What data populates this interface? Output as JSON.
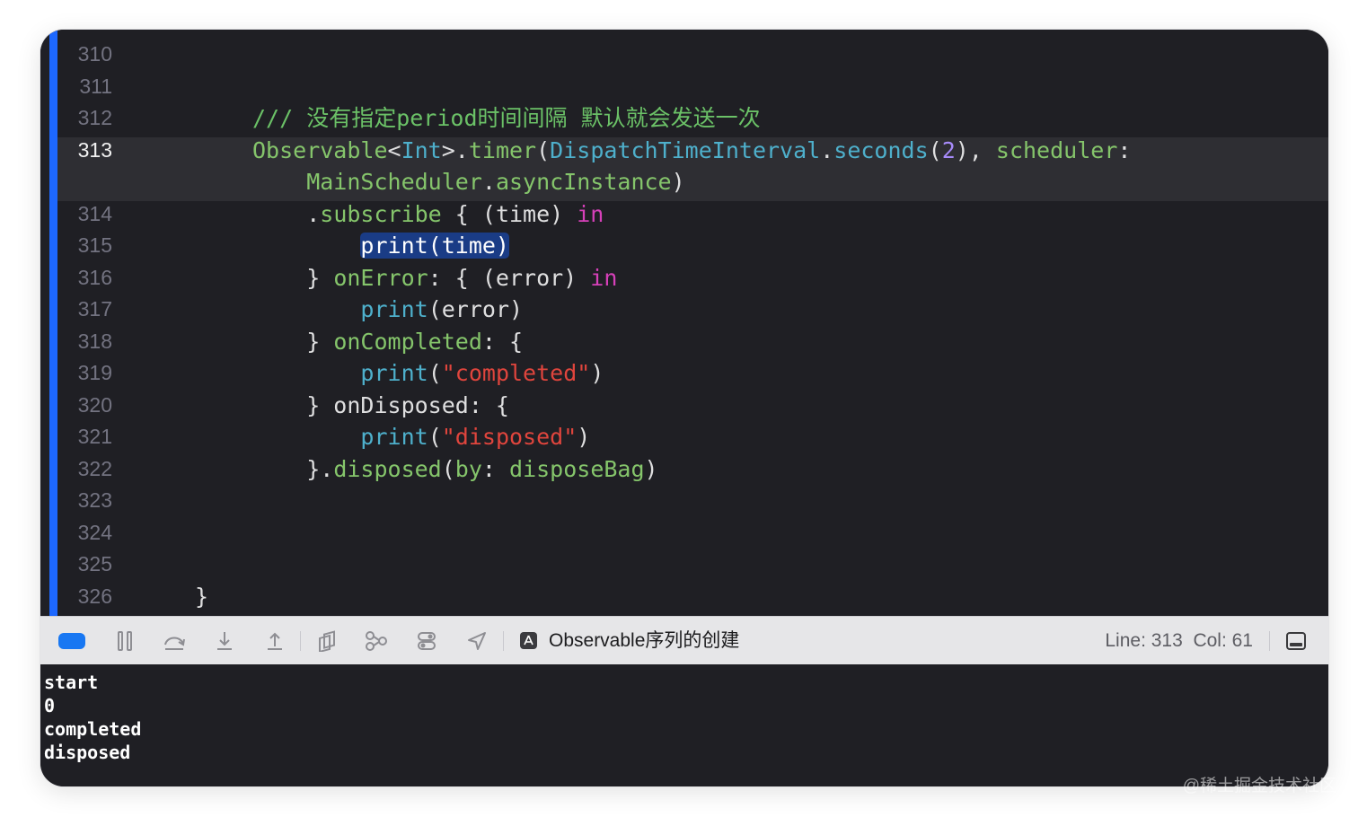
{
  "editor": {
    "lines": [
      {
        "num": "310",
        "current": false,
        "tokens": []
      },
      {
        "num": "311",
        "current": false,
        "tokens": []
      },
      {
        "num": "312",
        "current": false,
        "tokens": [
          {
            "t": "/// 没有指定period时间间隔 默认就会发送一次",
            "c": "c-comment"
          }
        ]
      },
      {
        "num": "313",
        "current": true,
        "tokens": [
          {
            "t": "Observable",
            "c": "c-green"
          },
          {
            "t": "<",
            "c": "c-white"
          },
          {
            "t": "Int",
            "c": "c-cyan"
          },
          {
            "t": ">.",
            "c": "c-white"
          },
          {
            "t": "timer",
            "c": "c-green"
          },
          {
            "t": "(",
            "c": "c-white"
          },
          {
            "t": "DispatchTimeInterval",
            "c": "c-cyan"
          },
          {
            "t": ".",
            "c": "c-white"
          },
          {
            "t": "seconds",
            "c": "c-cyan"
          },
          {
            "t": "(",
            "c": "c-white"
          },
          {
            "t": "2",
            "c": "c-num"
          },
          {
            "t": "), ",
            "c": "c-white"
          },
          {
            "t": "scheduler",
            "c": "c-green"
          },
          {
            "t": ":",
            "c": "c-white"
          }
        ]
      },
      {
        "num": "",
        "current": true,
        "tokens": [
          {
            "t": "    MainScheduler",
            "c": "c-green"
          },
          {
            "t": ".",
            "c": "c-white"
          },
          {
            "t": "asyncInstance",
            "c": "c-green"
          },
          {
            "t": ")",
            "c": "c-white"
          }
        ]
      },
      {
        "num": "314",
        "current": false,
        "tokens": [
          {
            "t": "    .",
            "c": "c-white"
          },
          {
            "t": "subscribe",
            "c": "c-green"
          },
          {
            "t": " { (time) ",
            "c": "c-white"
          },
          {
            "t": "in",
            "c": "c-kw"
          }
        ]
      },
      {
        "num": "315",
        "current": false,
        "tokens": [
          {
            "t": "        ",
            "c": "c-white"
          },
          {
            "t": "print(time)",
            "c": "sel"
          }
        ]
      },
      {
        "num": "316",
        "current": false,
        "tokens": [
          {
            "t": "    } ",
            "c": "c-white"
          },
          {
            "t": "onError",
            "c": "c-green"
          },
          {
            "t": ": { (error) ",
            "c": "c-white"
          },
          {
            "t": "in",
            "c": "c-kw"
          }
        ]
      },
      {
        "num": "317",
        "current": false,
        "tokens": [
          {
            "t": "        ",
            "c": "c-white"
          },
          {
            "t": "print",
            "c": "c-cyan"
          },
          {
            "t": "(error)",
            "c": "c-white"
          }
        ]
      },
      {
        "num": "318",
        "current": false,
        "tokens": [
          {
            "t": "    } ",
            "c": "c-white"
          },
          {
            "t": "onCompleted",
            "c": "c-green"
          },
          {
            "t": ": {",
            "c": "c-white"
          }
        ]
      },
      {
        "num": "319",
        "current": false,
        "tokens": [
          {
            "t": "        ",
            "c": "c-white"
          },
          {
            "t": "print",
            "c": "c-cyan"
          },
          {
            "t": "(",
            "c": "c-white"
          },
          {
            "t": "\"completed\"",
            "c": "c-str"
          },
          {
            "t": ")",
            "c": "c-white"
          }
        ]
      },
      {
        "num": "320",
        "current": false,
        "tokens": [
          {
            "t": "    } onDisposed: {",
            "c": "c-white"
          }
        ]
      },
      {
        "num": "321",
        "current": false,
        "tokens": [
          {
            "t": "        ",
            "c": "c-white"
          },
          {
            "t": "print",
            "c": "c-cyan"
          },
          {
            "t": "(",
            "c": "c-white"
          },
          {
            "t": "\"disposed\"",
            "c": "c-str"
          },
          {
            "t": ")",
            "c": "c-white"
          }
        ]
      },
      {
        "num": "322",
        "current": false,
        "tokens": [
          {
            "t": "    }.",
            "c": "c-white"
          },
          {
            "t": "disposed",
            "c": "c-green"
          },
          {
            "t": "(",
            "c": "c-white"
          },
          {
            "t": "by",
            "c": "c-green"
          },
          {
            "t": ": ",
            "c": "c-white"
          },
          {
            "t": "disposeBag",
            "c": "c-green"
          },
          {
            "t": ")",
            "c": "c-white"
          }
        ]
      },
      {
        "num": "323",
        "current": false,
        "tokens": []
      },
      {
        "num": "324",
        "current": false,
        "tokens": []
      },
      {
        "num": "325",
        "current": false,
        "tokens": []
      },
      {
        "num": "326",
        "current": false,
        "tokens": [
          {
            "t": "}",
            "c": "c-white",
            "outdent": true
          }
        ]
      }
    ]
  },
  "toolbar": {
    "scheme_name": "Observable序列的创建",
    "position": "Line: 313  Col: 61",
    "icons": [
      "breakpoints-toggle-icon",
      "pause-icon",
      "step-over-icon",
      "step-into-icon",
      "step-out-icon",
      "view-hierarchy-icon",
      "memory-graph-icon",
      "environment-overrides-icon",
      "location-icon",
      "app-icon",
      "hide-console-icon"
    ]
  },
  "console": {
    "output": [
      "start",
      "0",
      "completed",
      "disposed"
    ]
  },
  "watermark": "@稀土掘金技术社区"
}
